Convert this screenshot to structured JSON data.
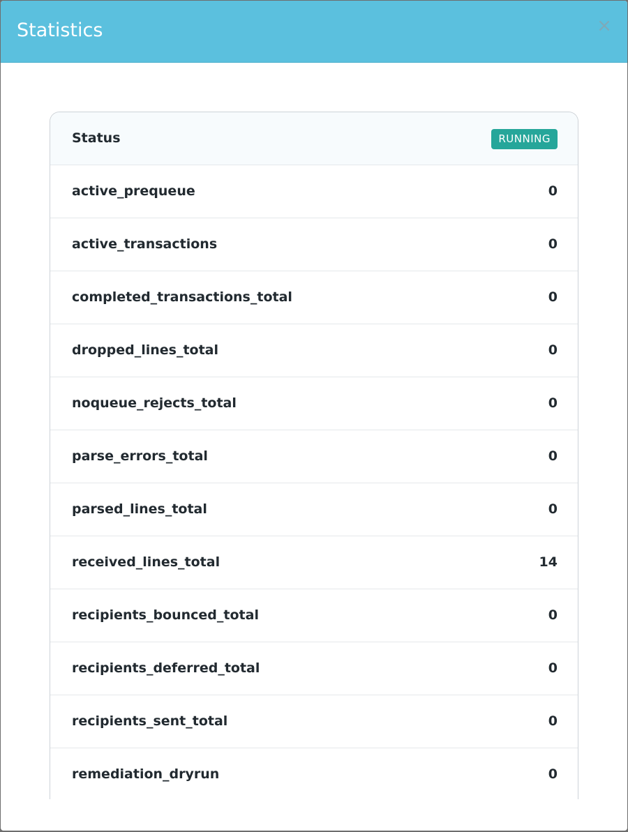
{
  "modal": {
    "title": "Statistics",
    "close_label": "×"
  },
  "status": {
    "label": "Status",
    "badge": "RUNNING",
    "badge_color": "#26a69a"
  },
  "stats": [
    {
      "name": "active_prequeue",
      "value": "0"
    },
    {
      "name": "active_transactions",
      "value": "0"
    },
    {
      "name": "completed_transactions_total",
      "value": "0"
    },
    {
      "name": "dropped_lines_total",
      "value": "0"
    },
    {
      "name": "noqueue_rejects_total",
      "value": "0"
    },
    {
      "name": "parse_errors_total",
      "value": "0"
    },
    {
      "name": "parsed_lines_total",
      "value": "0"
    },
    {
      "name": "received_lines_total",
      "value": "14"
    },
    {
      "name": "recipients_bounced_total",
      "value": "0"
    },
    {
      "name": "recipients_deferred_total",
      "value": "0"
    },
    {
      "name": "recipients_sent_total",
      "value": "0"
    },
    {
      "name": "remediation_dryrun",
      "value": "0"
    }
  ],
  "colors": {
    "header_bg": "#5bc0de",
    "badge_bg": "#26a69a"
  }
}
